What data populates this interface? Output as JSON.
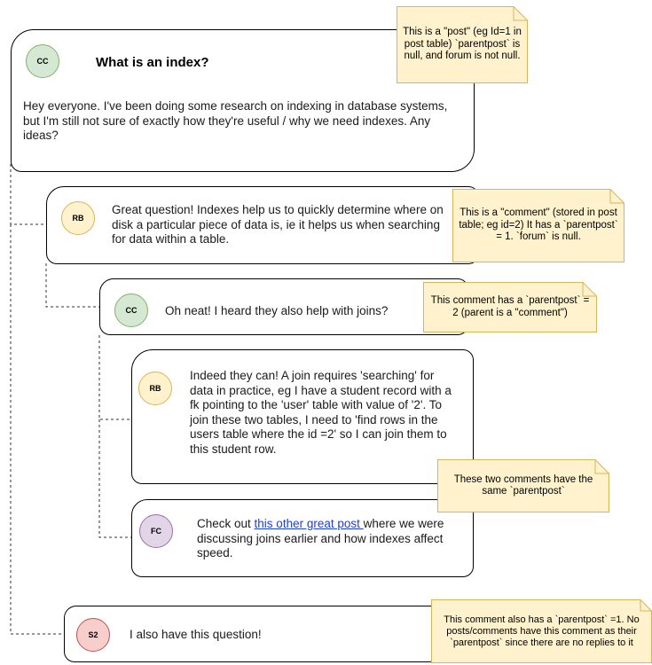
{
  "colors": {
    "cc": "#d5e8d4",
    "cc_border": "#82b366",
    "rb": "#fff2cc",
    "rb_border": "#d6b656",
    "fc": "#e1d5e7",
    "fc_border": "#9673a6",
    "s2": "#f8cecc",
    "s2_border": "#b85450",
    "note_fill": "#fff2cc",
    "note_border": "#d6b656",
    "link": "#1f3fd1"
  },
  "post": {
    "avatar": "CC",
    "title": "What is an index?",
    "body": "Hey everyone. I've been doing some research on indexing in database systems, but I'm still not sure of exactly how they're useful / why we need indexes. Any ideas?"
  },
  "comments": {
    "c1": {
      "avatar": "RB",
      "body": "Great question! Indexes help us to quickly determine where on disk a particular piece of data is, ie it helps us when searching for data within a table."
    },
    "c2": {
      "avatar": "CC",
      "body": "Oh neat! I heard they also help with joins?"
    },
    "c3": {
      "avatar": "RB",
      "body": "Indeed they can! A join requires 'searching' for data in practice, eg I have a student record with a fk pointing to the 'user' table with value of '2'. To join these two tables, I need to 'find rows in the users table where the id =2' so I can join them to this student row."
    },
    "c4": {
      "avatar": "FC",
      "body_before": "Check out ",
      "link_text": "this other great post ",
      "body_after": "where we were discussing joins earlier and how indexes affect speed."
    },
    "c5": {
      "avatar": "S2",
      "body": "I also have this question!"
    }
  },
  "notes": {
    "n1": "This is a \"post\" (eg Id=1 in post table) `parentpost` is null, and forum is not null.",
    "n2": "This is a \"comment\" (stored in post table; eg id=2) It has a `parentpost` = 1. `forum` is null.",
    "n3": "This comment has a `parentpost` = 2 (parent is a \"comment\")",
    "n4": "These two comments have the same `parentpost`",
    "n5": "This comment also has a `parentpost` =1. No posts/comments have this comment as their `parentpost` since there are no replies to it"
  }
}
